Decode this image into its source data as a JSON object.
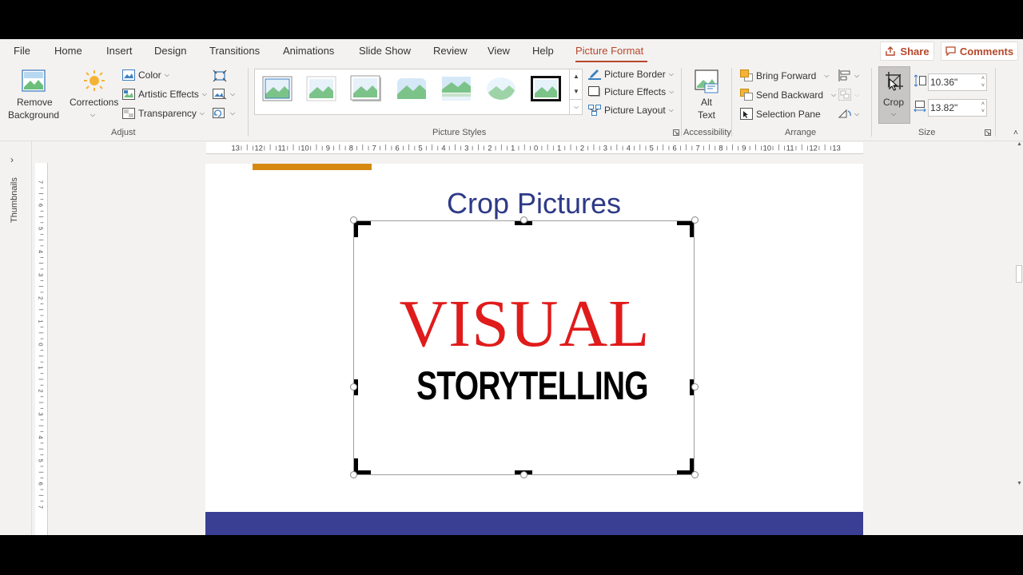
{
  "tabs": [
    {
      "label": "File",
      "name": "tab-file"
    },
    {
      "label": "Home",
      "name": "tab-home"
    },
    {
      "label": "Insert",
      "name": "tab-insert"
    },
    {
      "label": "Design",
      "name": "tab-design"
    },
    {
      "label": "Transitions",
      "name": "tab-transitions"
    },
    {
      "label": "Animations",
      "name": "tab-animations"
    },
    {
      "label": "Slide Show",
      "name": "tab-slide-show"
    },
    {
      "label": "Review",
      "name": "tab-review"
    },
    {
      "label": "View",
      "name": "tab-view"
    },
    {
      "label": "Help",
      "name": "tab-help"
    },
    {
      "label": "Picture Format",
      "name": "tab-picture-format"
    }
  ],
  "header": {
    "share_label": "Share",
    "comments_label": "Comments"
  },
  "ribbon": {
    "remove_background": [
      "Remove",
      "Background"
    ],
    "corrections": "Corrections",
    "color": "Color",
    "artistic_effects": "Artistic Effects",
    "transparency": "Transparency",
    "adjust_group": "Adjust",
    "picture_styles_group": "Picture Styles",
    "picture_border": "Picture Border",
    "picture_effects": "Picture Effects",
    "picture_layout": "Picture Layout",
    "alt_text": [
      "Alt",
      "Text"
    ],
    "accessibility_group": "Accessibility",
    "bring_forward": "Bring Forward",
    "send_backward": "Send Backward",
    "selection_pane": "Selection Pane",
    "arrange_group": "Arrange",
    "crop": "Crop",
    "height_value": "10.36\"",
    "width_value": "13.82\"",
    "size_group": "Size"
  },
  "left_pane": {
    "thumbnails_label": "Thumbnails"
  },
  "ruler": {
    "h_ticks": [
      "13",
      "12",
      "11",
      "10",
      "9",
      "8",
      "7",
      "6",
      "5",
      "4",
      "3",
      "2",
      "1",
      "0",
      "1",
      "2",
      "3",
      "4",
      "5",
      "6",
      "7",
      "8",
      "9",
      "10",
      "11",
      "12",
      "13"
    ],
    "v_ticks": [
      "7",
      "6",
      "5",
      "4",
      "3",
      "2",
      "1",
      "0",
      "1",
      "2",
      "3",
      "4",
      "5",
      "6",
      "7"
    ]
  },
  "slide": {
    "title": "Crop Pictures",
    "picture_line1": "VISUAL",
    "picture_line2": "STORYTELLING"
  },
  "colors": {
    "accent": "#b7472a",
    "title": "#2e3a87",
    "band": "#3a3f94",
    "bar": "#d68910",
    "visual_red": "#e01b1b"
  }
}
